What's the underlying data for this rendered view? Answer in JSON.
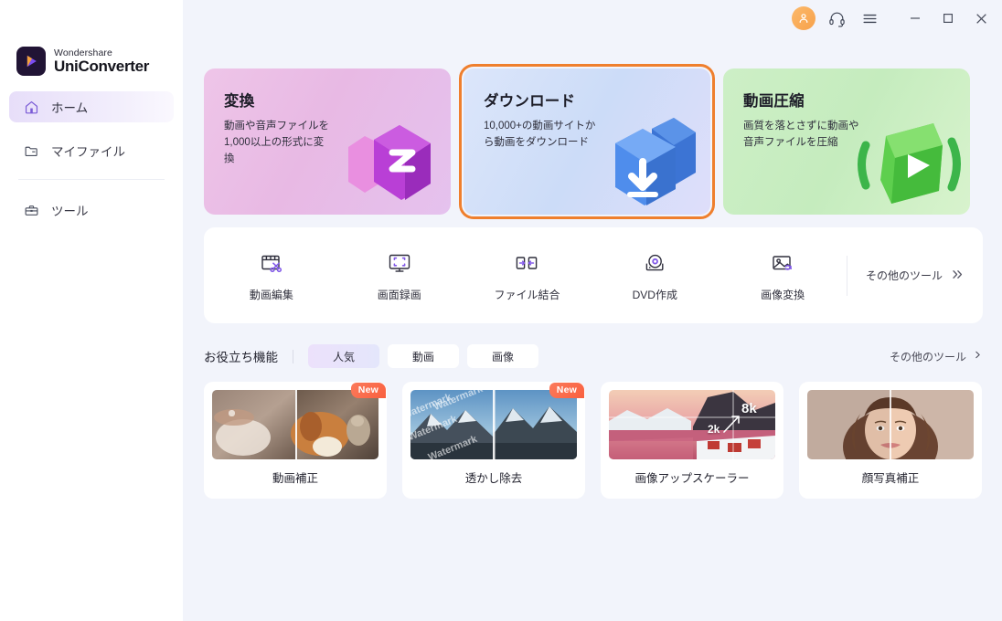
{
  "window": {
    "titlebar_icons": [
      {
        "name": "user-avatar-icon",
        "label": "アカウント"
      },
      {
        "name": "headset-support-icon",
        "label": "サポート"
      },
      {
        "name": "hamburger-menu-icon",
        "label": "メニュー"
      }
    ],
    "controls": [
      {
        "name": "minimize-button",
        "glyph": "—"
      },
      {
        "name": "maximize-button",
        "glyph": "□"
      },
      {
        "name": "close-button",
        "glyph": "✕"
      }
    ]
  },
  "sidebar": {
    "brand_top": "Wondershare",
    "brand_bottom": "UniConverter",
    "items": [
      {
        "label": "ホーム",
        "icon": "home-icon",
        "active": true
      },
      {
        "label": "マイファイル",
        "icon": "folder-icon",
        "active": false
      },
      {
        "label": "ツール",
        "icon": "toolbox-icon",
        "active": false
      }
    ]
  },
  "hero_cards": [
    {
      "title": "変換",
      "desc": "動画や音声ファイルを\n1,000以上の形式に変\n換",
      "icon": "convert-art-icon",
      "accent": "#c86fd2",
      "selected": false
    },
    {
      "title": "ダウンロード",
      "desc": "10,000+の動画サイトか\nら動画をダウンロード",
      "icon": "download-art-icon",
      "accent": "#4a86e8",
      "selected": true
    },
    {
      "title": "動画圧縮",
      "desc": "画質を落とさずに動画や\n音声ファイルを圧縮",
      "icon": "compress-art-icon",
      "accent": "#5ec24a",
      "selected": false
    }
  ],
  "tools": {
    "items": [
      {
        "label": "動画編集",
        "icon": "video-editor-icon"
      },
      {
        "label": "画面録画",
        "icon": "screen-recorder-icon"
      },
      {
        "label": "ファイル結合",
        "icon": "file-merger-icon"
      },
      {
        "label": "DVD作成",
        "icon": "dvd-burner-icon"
      },
      {
        "label": "画像変換",
        "icon": "image-converter-icon"
      }
    ],
    "more_label": "その他のツール",
    "more_icon": "double-chevron-right-icon"
  },
  "section": {
    "title": "お役立ち機能",
    "chips": [
      {
        "label": "人気",
        "active": true
      },
      {
        "label": "動画",
        "active": false
      },
      {
        "label": "画像",
        "active": false
      }
    ],
    "more_label": "その他のツール",
    "more_icon": "chevron-right-icon"
  },
  "features": [
    {
      "label": "動画補正",
      "badge": "New",
      "thumb": "video-enhancer-thumb"
    },
    {
      "label": "透かし除去",
      "badge": "New",
      "thumb": "watermark-remover-thumb",
      "watermark_text": "Watermark"
    },
    {
      "label": "画像アップスケーラー",
      "badge": "",
      "thumb": "image-upscaler-thumb",
      "from_label": "2k",
      "to_label": "8k"
    },
    {
      "label": "顔写真補正",
      "badge": "",
      "thumb": "portrait-retouch-thumb"
    }
  ],
  "colors": {
    "accent_selected": "#ef7f2d",
    "main_bg": "#f2f4fb",
    "sidebar_bg": "#ffffff",
    "badge": "#f9603f",
    "nav_active": "#e7def9"
  }
}
